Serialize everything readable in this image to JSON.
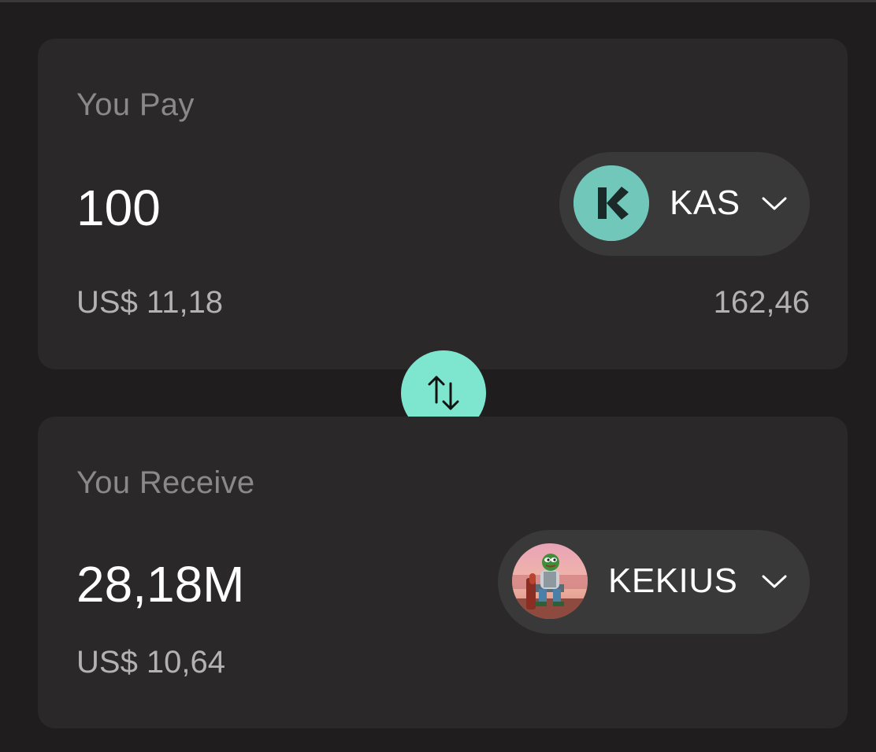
{
  "pay": {
    "label": "You Pay",
    "amount": "100",
    "fiat": "US$ 11,18",
    "balance": "162,46",
    "token": {
      "symbol": "KAS",
      "icon": "kaspa-logo-icon",
      "icon_bg": "#70c7ba"
    }
  },
  "receive": {
    "label": "You Receive",
    "amount": "28,18M",
    "fiat": "US$ 10,64",
    "token": {
      "symbol": "KEKIUS",
      "icon": "kekius-avatar-icon"
    }
  },
  "swap_button": {
    "icon": "swap-arrows-icon",
    "color": "#7ee6cf"
  },
  "colors": {
    "background": "#1f1d1e",
    "card": "#2a2829",
    "pill": "#3a3939"
  }
}
